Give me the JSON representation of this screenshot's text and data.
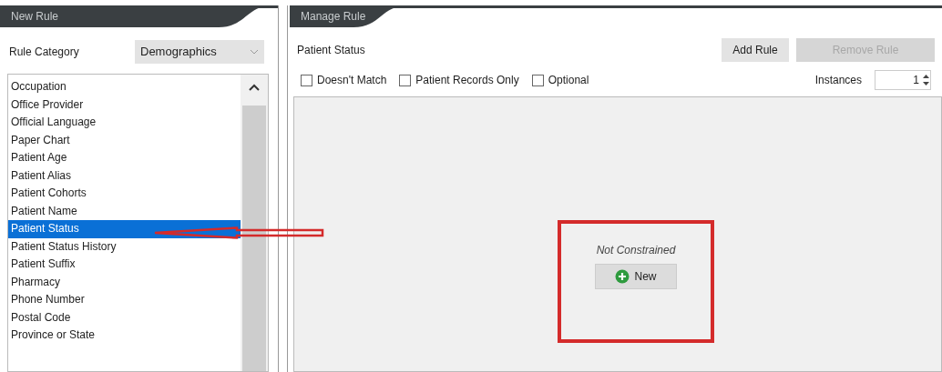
{
  "new_rule": {
    "title": "New Rule",
    "category_label": "Rule Category",
    "category_value": "Demographics",
    "items": [
      {
        "label": "Occupation",
        "selected": false
      },
      {
        "label": "Office Provider",
        "selected": false
      },
      {
        "label": "Official Language",
        "selected": false
      },
      {
        "label": "Paper Chart",
        "selected": false
      },
      {
        "label": "Patient Age",
        "selected": false
      },
      {
        "label": "Patient Alias",
        "selected": false
      },
      {
        "label": "Patient Cohorts",
        "selected": false
      },
      {
        "label": "Patient Name",
        "selected": false
      },
      {
        "label": "Patient Status",
        "selected": true
      },
      {
        "label": "Patient Status History",
        "selected": false
      },
      {
        "label": "Patient Suffix",
        "selected": false
      },
      {
        "label": "Pharmacy",
        "selected": false
      },
      {
        "label": "Phone Number",
        "selected": false
      },
      {
        "label": "Postal Code",
        "selected": false
      },
      {
        "label": "Province or State",
        "selected": false
      }
    ]
  },
  "manage_rule": {
    "title": "Manage Rule",
    "rule_name": "Patient Status",
    "buttons": [
      {
        "label": "Add Rule",
        "disabled": false
      },
      {
        "label": "Remove Rule",
        "disabled": true
      }
    ],
    "options": [
      {
        "label": "Doesn't Match",
        "checked": false
      },
      {
        "label": "Patient Records Only",
        "checked": false
      },
      {
        "label": "Optional",
        "checked": false
      }
    ],
    "instances_label": "Instances",
    "instances_value": "1",
    "constraint_text": "Not Constrained",
    "new_button": "New"
  }
}
